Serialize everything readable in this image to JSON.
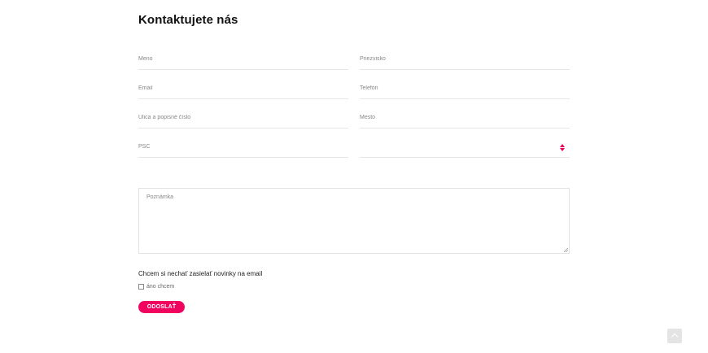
{
  "form": {
    "title": "Kontaktujete nás",
    "fields": {
      "first_name": {
        "placeholder": "Meno",
        "value": ""
      },
      "last_name": {
        "placeholder": "Priezvisko",
        "value": ""
      },
      "email": {
        "placeholder": "Email",
        "value": ""
      },
      "phone": {
        "placeholder": "Telefón",
        "value": ""
      },
      "street": {
        "placeholder": "Ulica a popisné číslo",
        "value": ""
      },
      "city": {
        "placeholder": "Mesto",
        "value": ""
      },
      "zip": {
        "placeholder": "PSČ",
        "value": ""
      },
      "country_select": {
        "value": ""
      }
    },
    "note": {
      "placeholder": "Poznámka",
      "value": ""
    },
    "newsletter": {
      "label": "Chcem si nechať zasielať novinky na email",
      "option_label": "áno chcem",
      "checked": false
    },
    "submit_label": "ODOSLAŤ"
  },
  "colors": {
    "accent": "#f0045f",
    "select_arrows": "#e8005a",
    "field_border": "#e6e6e6",
    "scroll_top_bg": "#e4e4e4"
  },
  "icons": {
    "select": "select-arrows-icon",
    "scroll_top": "chevron-up-icon",
    "resize": "resize-grip-icon"
  }
}
